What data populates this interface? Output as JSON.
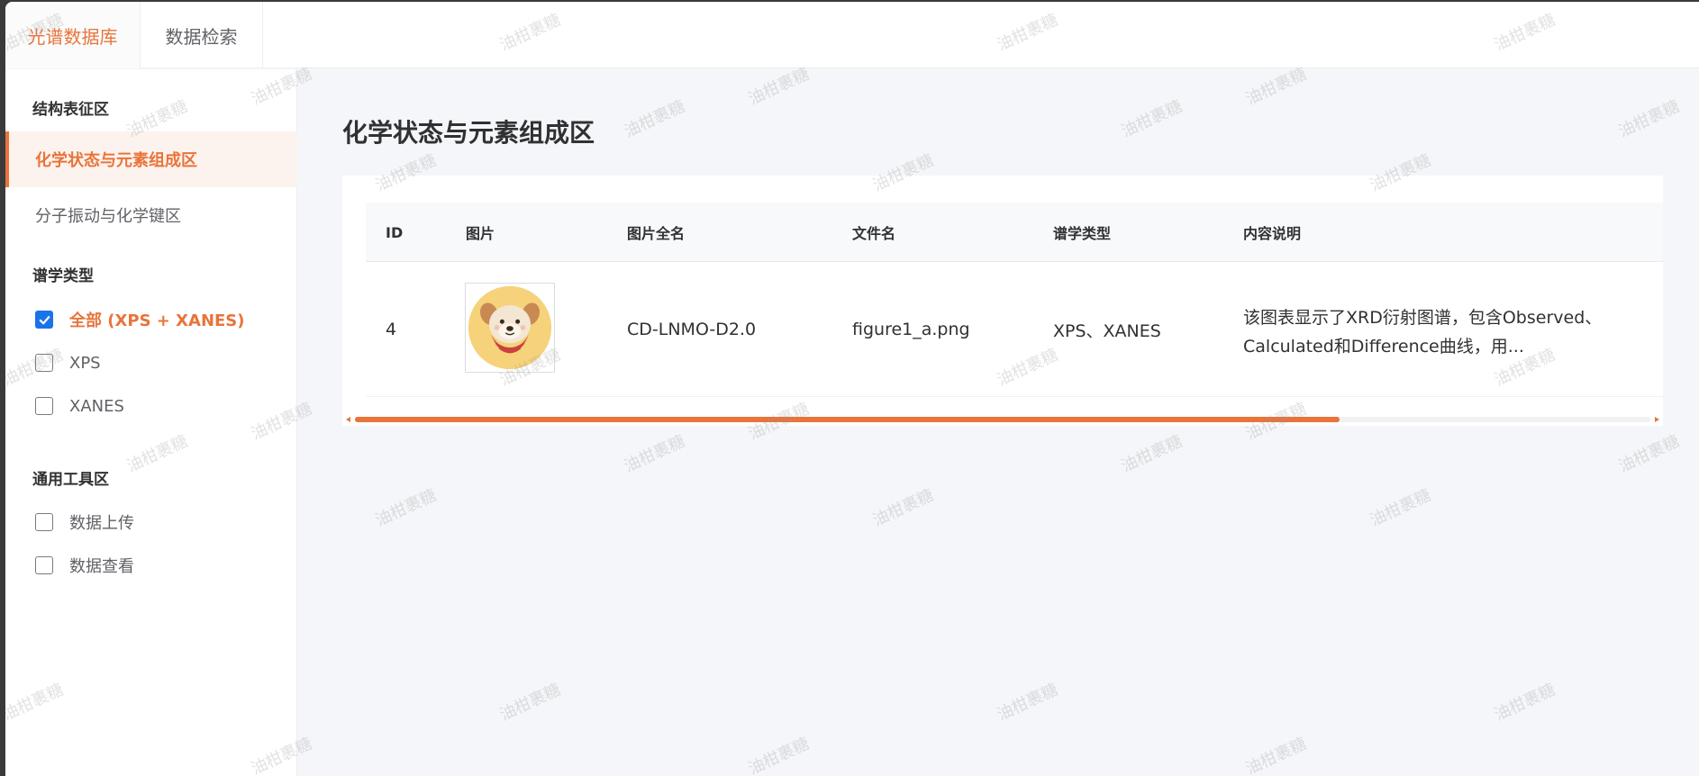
{
  "top_tabs": [
    {
      "label": "光谱数据库",
      "active": true
    },
    {
      "label": "数据检索",
      "active": false
    }
  ],
  "sidebar": {
    "group1_title": "结构表征区",
    "nav_items": [
      {
        "label": "化学状态与元素组成区",
        "active": true
      },
      {
        "label": "分子振动与化学键区",
        "active": false
      }
    ],
    "group2_title": "谱学类型",
    "spectrum_types": [
      {
        "label": "全部 (XPS + XANES)",
        "checked": true
      },
      {
        "label": "XPS",
        "checked": false
      },
      {
        "label": "XANES",
        "checked": false
      }
    ],
    "group3_title": "通用工具区",
    "tools": [
      {
        "label": "数据上传",
        "checked": false
      },
      {
        "label": "数据查看",
        "checked": false
      }
    ]
  },
  "main": {
    "page_title": "化学状态与元素组成区",
    "table": {
      "columns": [
        "ID",
        "图片",
        "图片全名",
        "文件名",
        "谱学类型",
        "内容说明"
      ],
      "rows": [
        {
          "id": "4",
          "image_icon": "dog-avatar-icon",
          "full_name": "CD-LNMO-D2.0",
          "file_name": "figure1_a.png",
          "spectrum_type": "XPS、XANES",
          "description": "该图表显示了XRD衍射图谱，包含Observed、Calculated和Difference曲线，用..."
        }
      ]
    },
    "scrollbar_position": 0.76
  },
  "watermark_text": "油柑裹糖",
  "colors": {
    "accent": "#e8743b",
    "checkbox": "#1a73e8",
    "background": "#f4f6f9"
  }
}
